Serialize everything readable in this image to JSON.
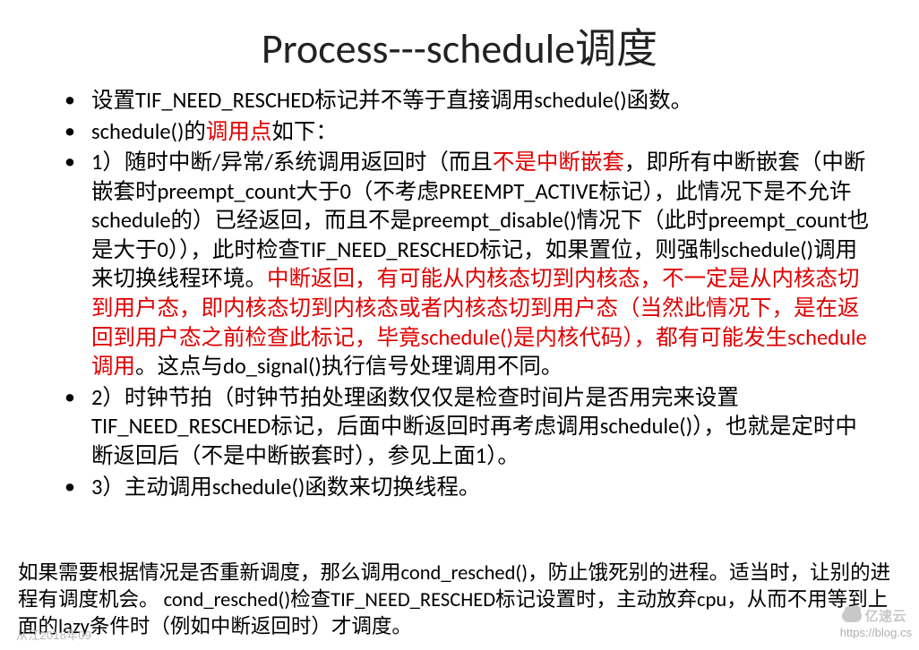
{
  "title": "Process---schedule调度",
  "bullets": {
    "b1": "设置TIF_NEED_RESCHED标记并不等于直接调用schedule()函数。",
    "b2_pre": "schedule()的",
    "b2_red": "调用点",
    "b2_post": "如下：",
    "b3_seg1": "1）随时中断/异常/系统调用返回时（而且",
    "b3_red1": "不是中断嵌套",
    "b3_seg2": "，即所有中断嵌套（中断嵌套时preempt_count大于0（不考虑PREEMPT_ACTIVE标记），此情况下是不允许schedule的）已经返回，而且不是preempt_disable()情况下（此时preempt_count也是大于0）），此时检查TIF_NEED_RESCHED标记，如果置位，则强制schedule()调用来切换线程环境。",
    "b3_red2": "中断返回，有可能从内核态切到内核态，不一定是从内核态切到用户态，即内核态切到内核态或者内核态切到用户态（当然此情况下，是在返回到用户态之前检查此标记，毕竟schedule()是内核代码），都有可能发生schedule调用",
    "b3_seg3": "。这点与do_signal()执行信号处理调用不同。",
    "b4": "2）时钟节拍（时钟节拍处理函数仅仅是检查时间片是否用完来设置TIF_NEED_RESCHED标记，后面中断返回时再考虑调用schedule()），也就是定时中断返回后（不是中断嵌套时），参见上面1）。",
    "b5": "3）主动调用schedule()函数来切换线程。"
  },
  "footer": "如果需要根据情况是否重新调度，那么调用cond_resched()，防止饿死别的进程。适当时，让别的进程有调度机会。 cond_resched()检查TIF_NEED_RESCHED标记设置时，主动放弃cpu，从而不用等到上面的lazy条件时（例如中断返回时）才调度。",
  "watermark_left": "从江2018年09",
  "watermark_right": "https://blog.cs",
  "watermark_logo_text": "亿速云"
}
